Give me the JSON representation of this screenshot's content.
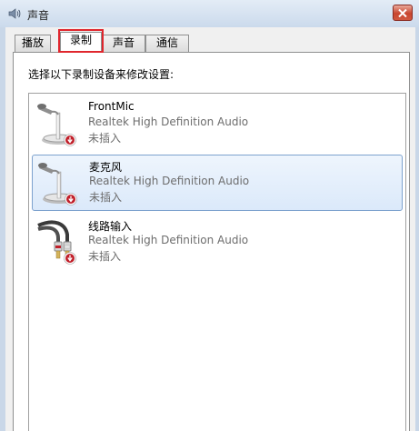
{
  "window": {
    "title": "声音",
    "close_icon": "close-icon"
  },
  "tabs": [
    {
      "label": "播放",
      "active": false
    },
    {
      "label": "录制",
      "active": true
    },
    {
      "label": "声音",
      "active": false
    },
    {
      "label": "通信",
      "active": false
    }
  ],
  "recording": {
    "instruction": "选择以下录制设备来修改设置:",
    "devices": [
      {
        "name": "FrontMic",
        "driver": "Realtek High Definition Audio",
        "status": "未插入",
        "icon": "microphone-icon",
        "selected": false
      },
      {
        "name": "麦克风",
        "driver": "Realtek High Definition Audio",
        "status": "未插入",
        "icon": "microphone-icon",
        "selected": true
      },
      {
        "name": "线路输入",
        "driver": "Realtek High Definition Audio",
        "status": "未插入",
        "icon": "line-in-cable-icon",
        "selected": false
      }
    ]
  },
  "colors": {
    "highlight_box": "#e0262d",
    "selection_border": "#7da2ce",
    "status_badge": "#c0202a"
  }
}
